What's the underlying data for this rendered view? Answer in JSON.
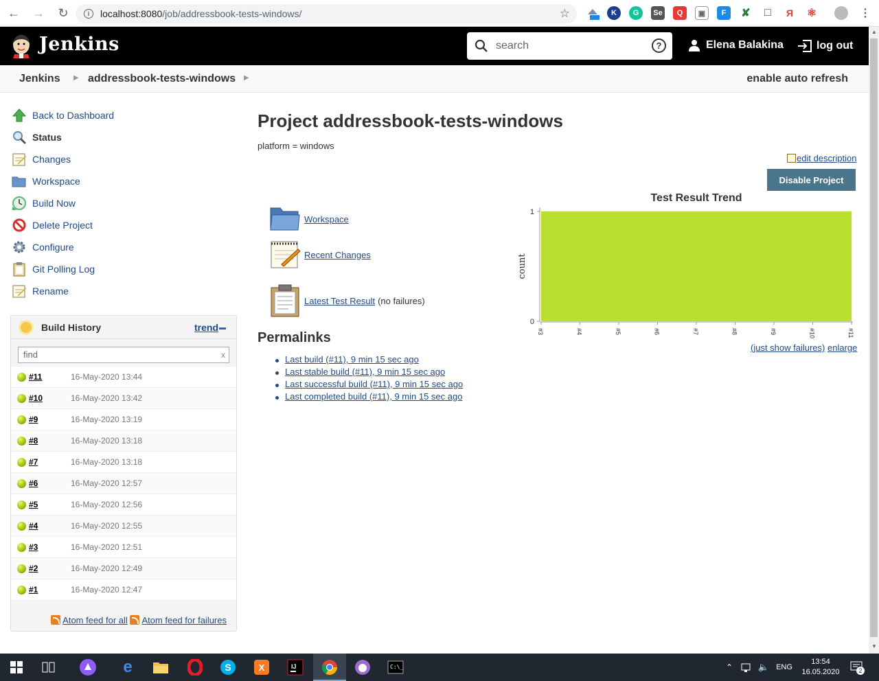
{
  "browser": {
    "url_host": "localhost:8080",
    "url_path": "/job/addressbook-tests-windows/"
  },
  "header": {
    "brand": "Jenkins",
    "search_placeholder": "search",
    "user_name": "Elena Balakina",
    "logout_label": "log out"
  },
  "breadcrumb": {
    "items": [
      "Jenkins",
      "addressbook-tests-windows"
    ],
    "auto_refresh": "enable auto refresh"
  },
  "side_tasks": [
    {
      "label": "Back to Dashboard",
      "icon": "up-arrow-icon"
    },
    {
      "label": "Status",
      "icon": "magnifier-icon"
    },
    {
      "label": "Changes",
      "icon": "notepad-icon"
    },
    {
      "label": "Workspace",
      "icon": "folder-icon"
    },
    {
      "label": "Build Now",
      "icon": "clock-icon"
    },
    {
      "label": "Delete Project",
      "icon": "no-entry-icon"
    },
    {
      "label": "Configure",
      "icon": "gear-icon"
    },
    {
      "label": "Git Polling Log",
      "icon": "clipboard-icon"
    },
    {
      "label": "Rename",
      "icon": "notepad-icon"
    }
  ],
  "build_history": {
    "title": "Build History",
    "trend_label": "trend",
    "find_placeholder": "find",
    "builds": [
      {
        "num": "#11",
        "date": "16-May-2020 13:44"
      },
      {
        "num": "#10",
        "date": "16-May-2020 13:42"
      },
      {
        "num": "#9",
        "date": "16-May-2020 13:19"
      },
      {
        "num": "#8",
        "date": "16-May-2020 13:18"
      },
      {
        "num": "#7",
        "date": "16-May-2020 13:18"
      },
      {
        "num": "#6",
        "date": "16-May-2020 12:57"
      },
      {
        "num": "#5",
        "date": "16-May-2020 12:56"
      },
      {
        "num": "#4",
        "date": "16-May-2020 12:55"
      },
      {
        "num": "#3",
        "date": "16-May-2020 12:51"
      },
      {
        "num": "#2",
        "date": "16-May-2020 12:49"
      },
      {
        "num": "#1",
        "date": "16-May-2020 12:47"
      }
    ],
    "feed_all": "Atom feed for all",
    "feed_failures": "Atom feed for failures"
  },
  "main": {
    "title": "Project addressbook-tests-windows",
    "description": "platform = windows",
    "edit_description": "edit description",
    "disable_button": "Disable Project",
    "links": {
      "workspace": "Workspace",
      "recent_changes": "Recent Changes",
      "latest_test_result": "Latest Test Result",
      "latest_test_result_suffix": "(no failures)"
    },
    "permalinks_title": "Permalinks",
    "permalinks": [
      "Last build (#11), 9 min 15 sec ago",
      "Last stable build (#11), 9 min 15 sec ago",
      "Last successful build (#11), 9 min 15 sec ago",
      "Last completed build (#11), 9 min 15 sec ago"
    ],
    "chart_links": {
      "just_failures": "(just show failures)",
      "enlarge": "enlarge"
    }
  },
  "chart_data": {
    "type": "area",
    "title": "Test Result Trend",
    "xlabel": "",
    "ylabel": "count",
    "categories": [
      "#3",
      "#4",
      "#5",
      "#6",
      "#7",
      "#8",
      "#9",
      "#10",
      "#11"
    ],
    "series": [
      {
        "values": [
          1,
          1,
          1,
          1,
          1,
          1,
          1,
          1,
          1
        ],
        "color": "#b9e02f"
      }
    ],
    "ylim": [
      0,
      1
    ],
    "yticks": [
      0,
      1
    ]
  },
  "taskbar": {
    "time": "13:54",
    "date": "16.05.2020",
    "lang": "ENG",
    "notifications": "2"
  }
}
